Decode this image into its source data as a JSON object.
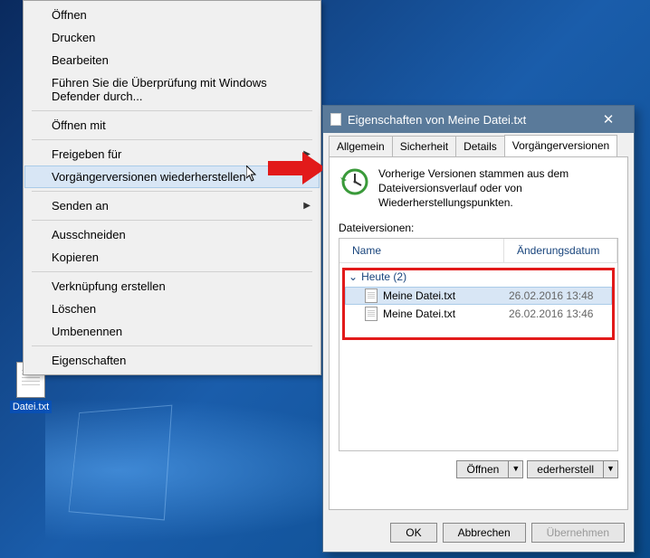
{
  "desktop": {
    "icon_label": "Datei.txt"
  },
  "context_menu": {
    "items": [
      {
        "label": "Öffnen"
      },
      {
        "label": "Drucken"
      },
      {
        "label": "Bearbeiten"
      },
      {
        "label": "Führen Sie die Überprüfung mit Windows Defender durch..."
      },
      {
        "sep": true
      },
      {
        "label": "Öffnen mit"
      },
      {
        "sep": true
      },
      {
        "label": "Freigeben für",
        "submenu": true
      },
      {
        "label": "Vorgängerversionen wiederherstellen",
        "hovered": true
      },
      {
        "sep": true
      },
      {
        "label": "Senden an",
        "submenu": true
      },
      {
        "sep": true
      },
      {
        "label": "Ausschneiden"
      },
      {
        "label": "Kopieren"
      },
      {
        "sep": true
      },
      {
        "label": "Verknüpfung erstellen"
      },
      {
        "label": "Löschen"
      },
      {
        "label": "Umbenennen"
      },
      {
        "sep": true
      },
      {
        "label": "Eigenschaften"
      }
    ]
  },
  "dialog": {
    "title": "Eigenschaften von Meine Datei.txt",
    "tabs": {
      "allgemein": "Allgemein",
      "sicherheit": "Sicherheit",
      "details": "Details",
      "vorganger": "Vorgängerversionen"
    },
    "info_text": "Vorherige Versionen stammen aus dem Dateiversionsverlauf oder von Wiederherstellungspunkten.",
    "dv_label": "Dateiversionen:",
    "columns": {
      "name": "Name",
      "date": "Änderungsdatum"
    },
    "group": "Heute (2)",
    "files": [
      {
        "name": "Meine Datei.txt",
        "date": "26.02.2016 13:48",
        "selected": true
      },
      {
        "name": "Meine Datei.txt",
        "date": "26.02.2016 13:46",
        "selected": false
      }
    ],
    "open_btn": "Öffnen",
    "restore_btn": "ederherstell",
    "buttons": {
      "ok": "OK",
      "cancel": "Abbrechen",
      "apply": "Übernehmen"
    }
  }
}
